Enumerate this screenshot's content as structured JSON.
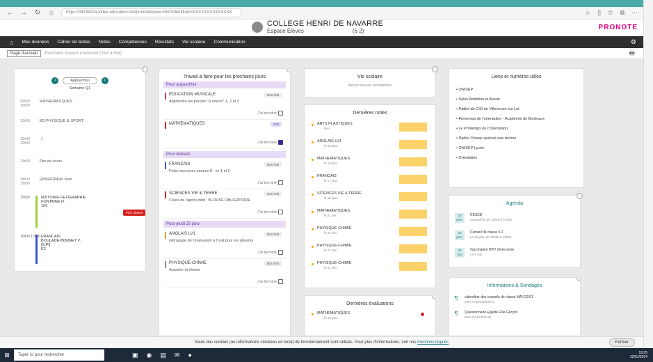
{
  "browser": {
    "url": "https://0473920a.index-education.net/pronote/eleve.html?identifiant=XXXXXXXXXXXXXX",
    "icons": [
      "back-icon",
      "forward-icon",
      "reload-icon",
      "home-icon"
    ]
  },
  "header": {
    "school": "COLLEGE HENRI DE NAVARRE",
    "space": "Espace Élèves",
    "class": "(6 2)",
    "brand_main": "PRONOTE"
  },
  "menu": [
    "Mes données",
    "Cahier de textes",
    "Notes",
    "Compétences",
    "Résultats",
    "Vie scolaire",
    "Communication"
  ],
  "subbar": {
    "active_tab": "Page d'accueil",
    "other_tab": "Prochains travaux à terminer (Tout à finir)"
  },
  "edt": {
    "day": "Aujourd'hui",
    "week": "Semaine Q1",
    "slots": [
      {
        "time": "09h00\n10h00",
        "name": "MATHEMATIQUES"
      },
      {
        "time": "10h00",
        "name": "ED.PHYSIQUE & SPORT."
      },
      {
        "time": "12h00\n13h00",
        "name": "🍴"
      },
      {
        "time": "13h00",
        "name": "Pas de cours"
      },
      {
        "time": "14h00\n15h00",
        "name": "ENSEIGNEM. libre"
      }
    ],
    "lessons": [
      {
        "time": "15h00",
        "name": "HISTOIRE-GEOGRAPHIE",
        "teacher": "FONTAINE O.",
        "room": "109",
        "status": "Prof. absent",
        "color": "#9fcf3a"
      },
      {
        "time": "16h00\n17h00",
        "name": "FRANCAIS",
        "teacher": "BOULADE-BONNET V.",
        "room": "[S.PI]",
        "extra": "E2",
        "color": "#3a55c8"
      }
    ]
  },
  "homework": {
    "title": "Travail à faire pour les prochains jours",
    "sections": [
      {
        "label": "Pour aujourd'hui",
        "items": [
          {
            "subject": "EDUCATION MUSICALE",
            "desc": "Apprendre les paroles \"à retenir\" 1, 2 et 3",
            "tag": "Non Fait",
            "done": false,
            "color": "#d42d7a"
          },
          {
            "subject": "MATHEMATIQUES",
            "desc": "",
            "tag": "Fait",
            "done": true,
            "color": "#d42020"
          }
        ]
      },
      {
        "label": "Pour demain",
        "items": [
          {
            "subject": "FRANCAIS",
            "desc": "Fiche exercices séance 8 : ex 1 et 2",
            "tag": "Non Fait",
            "done": false,
            "color": "#3a55c8"
          },
          {
            "subject": "SCIENCES VIE & TERRE",
            "desc": "Cours de l'après-midi : BLOUSE OBLIGATOIRE",
            "tag": "Non Fait",
            "done": false,
            "color": "#d42020"
          }
        ]
      },
      {
        "label": "Pour jeudi 25 janv.",
        "items": [
          {
            "subject": "ANGLAIS LV1",
            "desc": "rattrapage de l'évaluation à l'oral pour les absents",
            "tag": "Non Fait",
            "done": false,
            "color": "#e0a000"
          },
          {
            "subject": "PHYSIQUE-CHIMIE",
            "desc": "Apporter la blouse",
            "tag": "Non Fait",
            "done": false,
            "color": "#888"
          }
        ]
      }
    ],
    "done_label": "J'ai terminé"
  },
  "vie_scolaire": {
    "title": "Vie scolaire",
    "text": "Aucun nouvel événement"
  },
  "notes": {
    "title": "Dernières notes",
    "items": [
      {
        "subject": "ARTS PLASTIQUES",
        "date": "Hier"
      },
      {
        "subject": "ANGLAIS LV1",
        "date": "le 18 janv."
      },
      {
        "subject": "MATHEMATIQUES",
        "date": "le 18 janv."
      },
      {
        "subject": "FRANCAIS",
        "date": "le 17 janv."
      },
      {
        "subject": "SCIENCES VIE & TERRE",
        "date": "le 15 janv."
      },
      {
        "subject": "MATHEMATIQUES",
        "date": "le 21 déc."
      },
      {
        "subject": "PHYSIQUE-CHIMIE",
        "date": "le 21 déc."
      },
      {
        "subject": "PHYSIQUE-CHIMIE",
        "date": "le 21 déc."
      },
      {
        "subject": "PHYSIQUE-CHIMIE",
        "date": "le 21 déc."
      }
    ]
  },
  "evals": {
    "title": "Dernières évaluations",
    "items": [
      {
        "subject": "MATHEMATIQUES",
        "date": "le 18 janv."
      }
    ]
  },
  "links": {
    "title": "Liens et numéros utiles",
    "items": [
      "ONISEP",
      "Salon Ambition et Avenir",
      "Padlet du CIO de Villeneuve sur Lot",
      "Printemps de l'orientation - Académie de Bordeaux",
      "Le Printemps de l'Orientation",
      "Padlet Onisep spécial voie techno",
      "ONISEP Lycée",
      "Orientation"
    ]
  },
  "agenda": {
    "title": "Agenda",
    "items": [
      {
        "day": "22",
        "month": "janv.",
        "event": "CESCE",
        "detail": "Aujourd'hui de 13h00 à 13h00"
      },
      {
        "day": "25",
        "month": "janv.",
        "event": "Conseil de classe 6 2",
        "detail": "Le 25 janv. de 18h00 à 19h00"
      },
      {
        "day": "03",
        "month": "mai",
        "event": "Vaccination HPV 2ème dose",
        "detail": "Le 3 mai"
      }
    ]
  },
  "infos": {
    "title": "Informations & Sondages",
    "items": [
      {
        "event": "calendrier des conseils de classe MAJ 22/01",
        "detail": "Mme LABADESSE S."
      },
      {
        "event": "Questionnaire Egalité Fille Garçon",
        "detail": "Mme DI GUSTO M."
      }
    ]
  },
  "cookie": {
    "text": "Seuls des cookies (ou informations stockées en local) de fonctionnement sont utilisés. Pour plus d'informations, voir nos",
    "link": "mentions légales",
    "button": "Fermer"
  },
  "taskbar": {
    "search": "Taper ici pour rechercher",
    "time": "19:25",
    "date": "22/01/2024"
  }
}
